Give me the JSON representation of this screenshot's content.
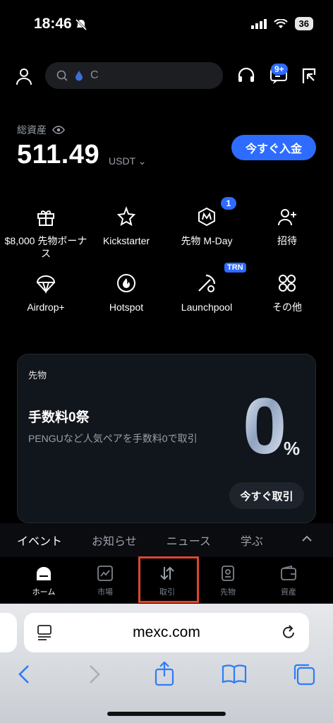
{
  "status": {
    "time": "18:46",
    "battery": "36"
  },
  "header": {
    "search_text": "C",
    "message_badge": "9+"
  },
  "assets": {
    "label": "総資産",
    "balance": "511.49",
    "unit": "USDT",
    "deposit_label": "今すぐ入金"
  },
  "grid": [
    {
      "label": "$8,000 先物ボーナス",
      "icon": "gift-icon"
    },
    {
      "label": "Kickstarter",
      "icon": "kickstarter-icon"
    },
    {
      "label": "先物 M-Day",
      "icon": "m-day-icon",
      "badge": "1"
    },
    {
      "label": "招待",
      "icon": "invite-icon"
    },
    {
      "label": "Airdrop+",
      "icon": "airdrop-icon"
    },
    {
      "label": "Hotspot",
      "icon": "hotspot-icon"
    },
    {
      "label": "Launchpool",
      "icon": "launchpool-icon",
      "badge": "TRN"
    },
    {
      "label": "その他",
      "icon": "more-icon"
    }
  ],
  "promo": {
    "tag": "先物",
    "title": "手数料0祭",
    "description": "PENGUなど人気ペアを手数料0で取引",
    "big_text": "0",
    "percent": "%",
    "button_label": "今すぐ取引"
  },
  "news_tabs": [
    "イベント",
    "お知らせ",
    "ニュース",
    "学ぶ"
  ],
  "bottom_nav": [
    {
      "label": "ホーム",
      "icon": "home-icon",
      "active": true
    },
    {
      "label": "市場",
      "icon": "market-icon",
      "active": false
    },
    {
      "label": "取引",
      "icon": "trade-icon",
      "active": false
    },
    {
      "label": "先物",
      "icon": "futures-icon",
      "active": false
    },
    {
      "label": "資産",
      "icon": "wallet-icon",
      "active": false
    }
  ],
  "browser": {
    "url": "mexc.com"
  },
  "colors": {
    "accent": "#2d6cff",
    "highlight": "#e0452d",
    "background": "#000000"
  }
}
